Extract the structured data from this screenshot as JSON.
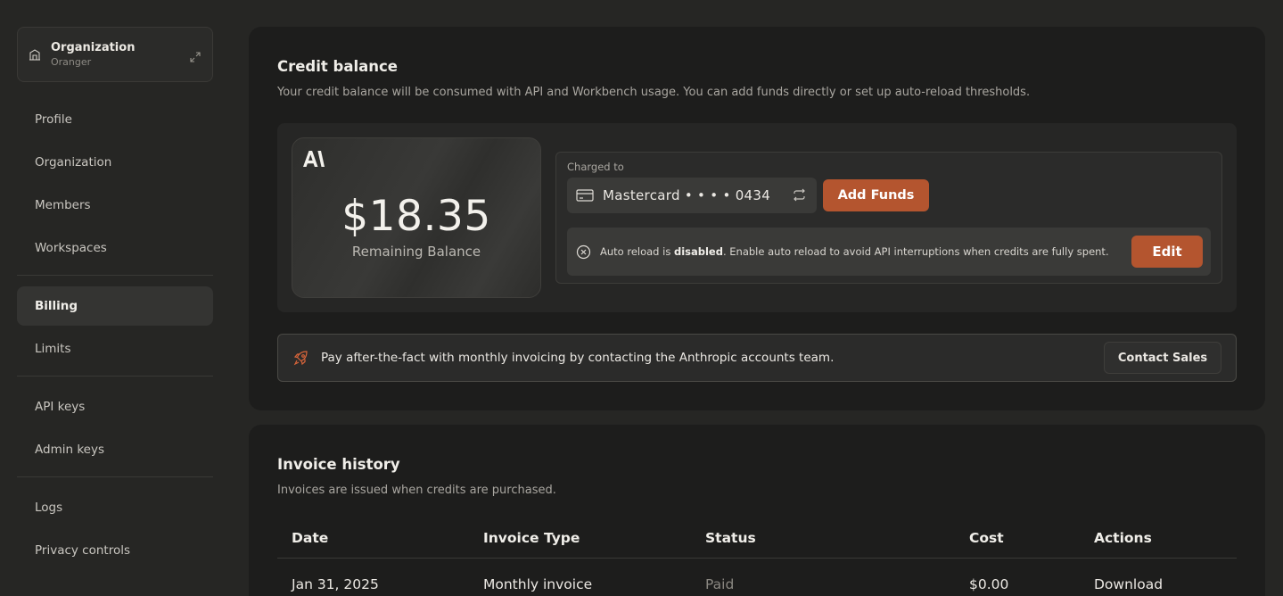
{
  "sidebar": {
    "org_switcher": {
      "name": "Organization",
      "subtitle": "Oranger"
    },
    "groups": [
      [
        "Profile",
        "Organization",
        "Members",
        "Workspaces"
      ],
      [
        "Billing",
        "Limits"
      ],
      [
        "API keys",
        "Admin keys"
      ],
      [
        "Logs",
        "Privacy controls"
      ]
    ],
    "active": "Billing"
  },
  "credit": {
    "title": "Credit balance",
    "description": "Your credit balance will be consumed with API and Workbench usage. You can add funds directly or set up auto-reload thresholds.",
    "amount": "$18.35",
    "amount_label": "Remaining Balance",
    "charged_to_label": "Charged to",
    "card_text": "Mastercard • • • • 0434",
    "add_funds_label": "Add Funds",
    "auto_reload_prefix": "Auto reload is ",
    "auto_reload_status": "disabled",
    "auto_reload_suffix": ". Enable auto reload to avoid API interruptions when credits are fully spent.",
    "edit_label": "Edit",
    "sales_text": "Pay after-the-fact with monthly invoicing by contacting the Anthropic accounts team.",
    "contact_sales_label": "Contact Sales"
  },
  "invoices": {
    "title": "Invoice history",
    "description": "Invoices are issued when credits are purchased.",
    "columns": [
      "Date",
      "Invoice Type",
      "Status",
      "Cost",
      "Actions"
    ],
    "rows": [
      {
        "date": "Jan 31, 2025",
        "type": "Monthly invoice",
        "status": "Paid",
        "cost": "$0.00",
        "action": "Download"
      }
    ]
  },
  "colors": {
    "accent": "#b4552f",
    "background": "#262624",
    "card": "#1d1d1c"
  },
  "icons": [
    "building-icon",
    "expand-icon",
    "anthropic-logo",
    "credit-card-icon",
    "swap-icon",
    "x-circle-icon",
    "rocket-icon"
  ]
}
